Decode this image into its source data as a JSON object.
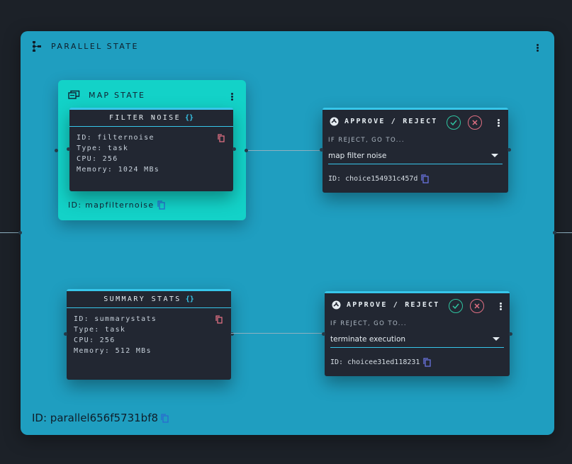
{
  "parallel_state": {
    "title": "PARALLEL STATE",
    "id": "ID: parallel656f5731bf8"
  },
  "map_state": {
    "title": "MAP STATE",
    "id": "ID: mapfilternoise"
  },
  "tasks": [
    {
      "title": "FILTER NOISE",
      "braces": "{}",
      "lines": [
        "ID: filternoise",
        "Type: task",
        "CPU: 256",
        "Memory: 1024 MBs"
      ]
    },
    {
      "title": "SUMMARY STATS",
      "braces": "{}",
      "lines": [
        "ID: summarystats",
        "Type: task",
        "CPU: 256",
        "Memory: 512 MBs"
      ]
    }
  ],
  "choices": [
    {
      "title": "APPROVE / REJECT",
      "label": "IF REJECT, GO TO...",
      "selected": "map filter noise",
      "id": "ID: choice154931c457d"
    },
    {
      "title": "APPROVE / REJECT",
      "label": "IF REJECT, GO TO...",
      "selected": "terminate execution",
      "id": "ID: choicee31ed118231"
    }
  ],
  "colors": {
    "background": "#1c2128",
    "parallel": "#1f9ec0",
    "map": "#13d2c8",
    "card": "#222732",
    "accent": "#37c6ea",
    "approve": "#2fc4a0",
    "reject": "#e06f82"
  }
}
